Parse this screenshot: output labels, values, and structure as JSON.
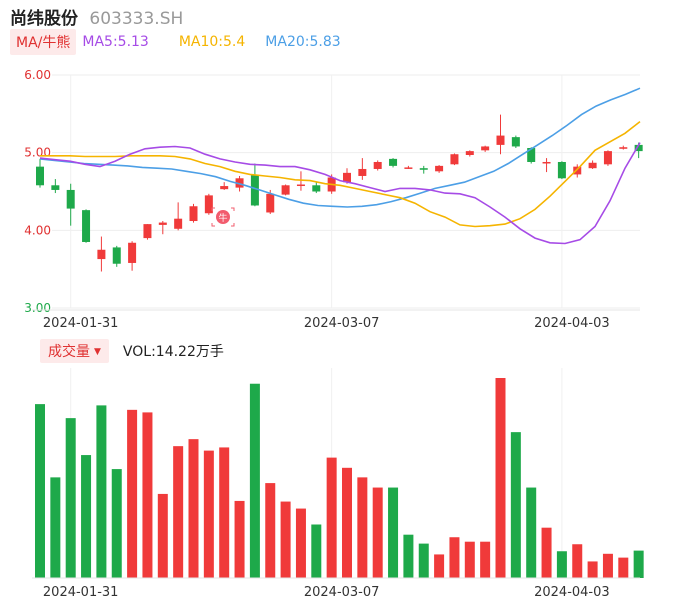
{
  "header": {
    "name": "尚纬股份",
    "code": "603333.SH"
  },
  "legend": {
    "ma_tab": "MA/牛熊",
    "ma5": "MA5:5.13",
    "ma10": "MA10:5.4",
    "ma20": "MA20:5.83"
  },
  "volume_legend": {
    "tab": "成交量",
    "value": "VOL:14.22万手"
  },
  "colors": {
    "up": "#f03a3a",
    "down": "#1ea94a",
    "ma5": "#a64be6",
    "ma10": "#f5b400",
    "ma20": "#4c9fe6",
    "axis_label": "#e03131",
    "bottom_label": "#1ea94a"
  },
  "chart_data": [
    {
      "type": "candlestick",
      "ylim": [
        3.0,
        6.0
      ],
      "yticks": [
        "6.00",
        "5.00",
        "4.00",
        "3.00"
      ],
      "x_tick_labels": [
        {
          "index": 2,
          "label": "2024-01-31"
        },
        {
          "index": 19,
          "label": "2024-03-07"
        },
        {
          "index": 34,
          "label": "2024-04-03"
        }
      ],
      "candles": [
        {
          "o": 4.82,
          "c": 4.58,
          "h": 4.92,
          "l": 4.55
        },
        {
          "o": 4.58,
          "c": 4.52,
          "h": 4.66,
          "l": 4.48
        },
        {
          "o": 4.52,
          "c": 4.28,
          "h": 4.6,
          "l": 4.06
        },
        {
          "o": 4.26,
          "c": 3.85,
          "h": 4.27,
          "l": 3.84
        },
        {
          "o": 3.63,
          "c": 3.75,
          "h": 3.92,
          "l": 3.47
        },
        {
          "o": 3.78,
          "c": 3.57,
          "h": 3.8,
          "l": 3.53
        },
        {
          "o": 3.58,
          "c": 3.84,
          "h": 3.86,
          "l": 3.48
        },
        {
          "o": 3.9,
          "c": 4.08,
          "h": 4.08,
          "l": 3.88
        },
        {
          "o": 4.07,
          "c": 4.1,
          "h": 4.12,
          "l": 3.95
        },
        {
          "o": 4.02,
          "c": 4.15,
          "h": 4.36,
          "l": 4.0
        },
        {
          "o": 4.12,
          "c": 4.31,
          "h": 4.34,
          "l": 4.1
        },
        {
          "o": 4.22,
          "c": 4.45,
          "h": 4.47,
          "l": 4.2
        },
        {
          "o": 4.53,
          "c": 4.57,
          "h": 4.62,
          "l": 4.52
        },
        {
          "o": 4.55,
          "c": 4.67,
          "h": 4.7,
          "l": 4.5
        },
        {
          "o": 4.71,
          "c": 4.32,
          "h": 4.86,
          "l": 4.31
        },
        {
          "o": 4.23,
          "c": 4.47,
          "h": 4.52,
          "l": 4.21
        },
        {
          "o": 4.46,
          "c": 4.58,
          "h": 4.59,
          "l": 4.45
        },
        {
          "o": 4.59,
          "c": 4.59,
          "h": 4.76,
          "l": 4.51
        },
        {
          "o": 4.58,
          "c": 4.5,
          "h": 4.62,
          "l": 4.48
        },
        {
          "o": 4.5,
          "c": 4.68,
          "h": 4.72,
          "l": 4.47
        },
        {
          "o": 4.62,
          "c": 4.74,
          "h": 4.8,
          "l": 4.6
        },
        {
          "o": 4.7,
          "c": 4.79,
          "h": 4.93,
          "l": 4.65
        },
        {
          "o": 4.79,
          "c": 4.88,
          "h": 4.9,
          "l": 4.77
        },
        {
          "o": 4.92,
          "c": 4.83,
          "h": 4.93,
          "l": 4.81
        },
        {
          "o": 4.81,
          "c": 4.81,
          "h": 4.83,
          "l": 4.79
        },
        {
          "o": 4.8,
          "c": 4.78,
          "h": 4.83,
          "l": 4.73
        },
        {
          "o": 4.76,
          "c": 4.83,
          "h": 4.84,
          "l": 4.74
        },
        {
          "o": 4.85,
          "c": 4.98,
          "h": 4.99,
          "l": 4.84
        },
        {
          "o": 4.97,
          "c": 5.02,
          "h": 5.03,
          "l": 4.95
        },
        {
          "o": 5.03,
          "c": 5.08,
          "h": 5.09,
          "l": 5.01
        },
        {
          "o": 5.1,
          "c": 5.22,
          "h": 5.49,
          "l": 4.98
        },
        {
          "o": 5.2,
          "c": 5.08,
          "h": 5.22,
          "l": 5.06
        },
        {
          "o": 5.06,
          "c": 4.88,
          "h": 5.07,
          "l": 4.86
        },
        {
          "o": 4.87,
          "c": 4.88,
          "h": 4.93,
          "l": 4.75
        },
        {
          "o": 4.88,
          "c": 4.67,
          "h": 4.89,
          "l": 4.66
        },
        {
          "o": 4.72,
          "c": 4.82,
          "h": 4.85,
          "l": 4.68
        },
        {
          "o": 4.8,
          "c": 4.87,
          "h": 4.9,
          "l": 4.79
        },
        {
          "o": 4.85,
          "c": 5.02,
          "h": 5.03,
          "l": 4.83
        },
        {
          "o": 5.05,
          "c": 5.07,
          "h": 5.09,
          "l": 5.04
        },
        {
          "o": 5.1,
          "c": 5.02,
          "h": 5.13,
          "l": 4.93
        }
      ],
      "ma5": [
        4.93,
        4.91,
        4.89,
        4.85,
        4.82,
        4.89,
        4.98,
        5.05,
        5.07,
        5.08,
        5.06,
        4.98,
        4.92,
        4.88,
        4.85,
        4.84,
        4.82,
        4.82,
        4.78,
        4.72,
        4.64,
        4.6,
        4.55,
        4.5,
        4.54,
        4.54,
        4.52,
        4.48,
        4.47,
        4.42,
        4.3,
        4.17,
        4.02,
        3.9,
        3.84,
        3.83,
        3.88,
        4.05,
        4.38,
        4.8,
        5.13
      ],
      "ma10": [
        4.96,
        4.96,
        4.96,
        4.95,
        4.95,
        4.95,
        4.96,
        4.96,
        4.96,
        4.95,
        4.92,
        4.86,
        4.82,
        4.76,
        4.72,
        4.7,
        4.68,
        4.65,
        4.64,
        4.6,
        4.58,
        4.54,
        4.5,
        4.46,
        4.42,
        4.35,
        4.24,
        4.17,
        4.07,
        4.05,
        4.06,
        4.08,
        4.15,
        4.27,
        4.44,
        4.63,
        4.82,
        5.03,
        5.14,
        5.25,
        5.4
      ],
      "ma20": [
        4.92,
        4.9,
        4.88,
        4.86,
        4.85,
        4.84,
        4.83,
        4.81,
        4.8,
        4.79,
        4.76,
        4.73,
        4.69,
        4.63,
        4.58,
        4.52,
        4.46,
        4.4,
        4.35,
        4.32,
        4.31,
        4.3,
        4.31,
        4.33,
        4.37,
        4.42,
        4.48,
        4.54,
        4.58,
        4.62,
        4.69,
        4.76,
        4.86,
        4.98,
        5.1,
        5.22,
        5.35,
        5.49,
        5.6,
        5.68,
        5.75,
        5.83
      ]
    },
    {
      "type": "bar",
      "title": "成交量",
      "x_tick_labels": [
        {
          "index": 2,
          "label": "2024-01-31"
        },
        {
          "index": 19,
          "label": "2024-03-07"
        },
        {
          "index": 34,
          "label": "2024-04-03"
        }
      ],
      "values": [
        27.3,
        15.8,
        25.1,
        19.3,
        27.1,
        17.1,
        26.4,
        26.0,
        13.2,
        20.7,
        21.8,
        20.0,
        20.5,
        12.1,
        30.5,
        14.9,
        12.0,
        10.9,
        8.4,
        18.9,
        17.3,
        15.8,
        14.2,
        14.2,
        6.8,
        5.4,
        3.7,
        6.4,
        5.7,
        5.7,
        31.4,
        22.9,
        14.2,
        7.9,
        4.2,
        5.3,
        2.6,
        3.8,
        3.2,
        4.3
      ],
      "directions": [
        "down",
        "down",
        "down",
        "down",
        "down",
        "down",
        "up",
        "up",
        "up",
        "up",
        "up",
        "up",
        "up",
        "up",
        "down",
        "up",
        "up",
        "up",
        "down",
        "up",
        "up",
        "up",
        "up",
        "down",
        "down",
        "down",
        "up",
        "up",
        "up",
        "up",
        "up",
        "down",
        "down",
        "up",
        "down",
        "up",
        "up",
        "up",
        "up",
        "down"
      ]
    }
  ],
  "badge": {
    "label": "牛"
  }
}
